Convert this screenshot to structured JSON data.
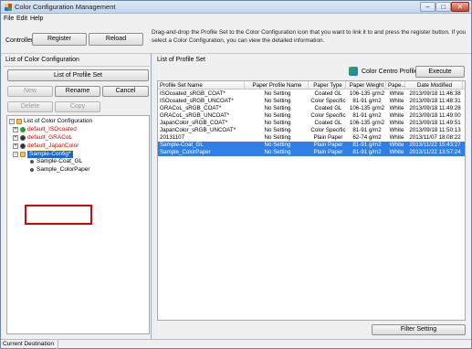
{
  "window": {
    "title": "Color Configuration Management",
    "buttons": {
      "minimize": "–",
      "maximize": "□",
      "close": "✕"
    }
  },
  "menu": [
    {
      "label": "File"
    },
    {
      "label": "Edit"
    },
    {
      "label": "Help"
    }
  ],
  "toolbar": {
    "controller_label": "Controller",
    "register_label": "Register",
    "reload_label": "Reload",
    "info_text": "Drag-and-drop the Profile Set to the Color Configuration icon that you want to link it to and press the register button. If you select a Color Configuration, you can view the detailed information."
  },
  "left": {
    "header": "List of Color Configuration",
    "list_profile_set_button": "List of Profile Set",
    "new_button": "New",
    "rename_button": "Rename",
    "cancel_button": "Cancel",
    "delete_button": "Delete",
    "copy_button": "Copy",
    "tree": {
      "root": "List of Color Configuration",
      "items": [
        {
          "label": "default_ISOcoated",
          "color": "#e00000"
        },
        {
          "label": "default_GRACoL",
          "color": "#e00000"
        },
        {
          "label": "default_JapanColor",
          "color": "#e00000"
        }
      ],
      "selected": "Sample-Config*",
      "children": [
        {
          "label": "Sample-Coat_GL"
        },
        {
          "label": "Sample_ColorPaper"
        }
      ]
    }
  },
  "right": {
    "header": "List of Profile Set",
    "color_centro_label": "Color Centro Profiler :",
    "execute_button": "Execute",
    "filter_button": "Filter Setting",
    "columns": [
      "Profile Set Name",
      "Paper Profile Name",
      "Paper Type",
      "Paper Weight",
      "Pape...",
      "Date Modified"
    ],
    "rows": [
      {
        "cells": [
          "ISOcoated_sRGB_COAT*",
          "No Setting",
          "Coated GL",
          "106-135 g/m2",
          "White",
          "2013/09/18 11:46:38"
        ],
        "selected": false
      },
      {
        "cells": [
          "ISOcoated_sRGB_UNCOAT*",
          "No Setting",
          "Color Specific",
          "81-91 g/m2",
          "White",
          "2013/09/18 11:48:31"
        ],
        "selected": false
      },
      {
        "cells": [
          "GRACoL_sRGB_COAT*",
          "No Setting",
          "Coated GL",
          "106-135 g/m2",
          "White",
          "2013/09/18 11:49:28"
        ],
        "selected": false
      },
      {
        "cells": [
          "GRACoL_sRGB_UNCOAT*",
          "No Setting",
          "Color Specific",
          "81-91 g/m2",
          "White",
          "2013/09/18 11:49:00"
        ],
        "selected": false
      },
      {
        "cells": [
          "JapanColor_sRGB_COAT*",
          "No Setting",
          "Coated GL",
          "106-135 g/m2",
          "White",
          "2013/09/18 11:49:51"
        ],
        "selected": false
      },
      {
        "cells": [
          "JapanColor_sRGB_UNCOAT*",
          "No Setting",
          "Color Specific",
          "81-91 g/m2",
          "White",
          "2013/09/18 11:50:13"
        ],
        "selected": false
      },
      {
        "cells": [
          "20131107",
          "No Setting",
          "Plain Paper",
          "62-74 g/m2",
          "White",
          "2013/11/07 18:08:22"
        ],
        "selected": false
      },
      {
        "cells": [
          "Sample-Coat_GL",
          "No Setting",
          "Plain Paper",
          "81-91 g/m2",
          "White",
          "2013/11/22 15:43:27"
        ],
        "selected": true
      },
      {
        "cells": [
          "Sample_ColorPaper",
          "No Setting",
          "Plain Paper",
          "81-91 g/m2",
          "White",
          "2013/11/22 13:57:24"
        ],
        "selected": true
      }
    ]
  },
  "status": {
    "text": "Current Destination"
  }
}
